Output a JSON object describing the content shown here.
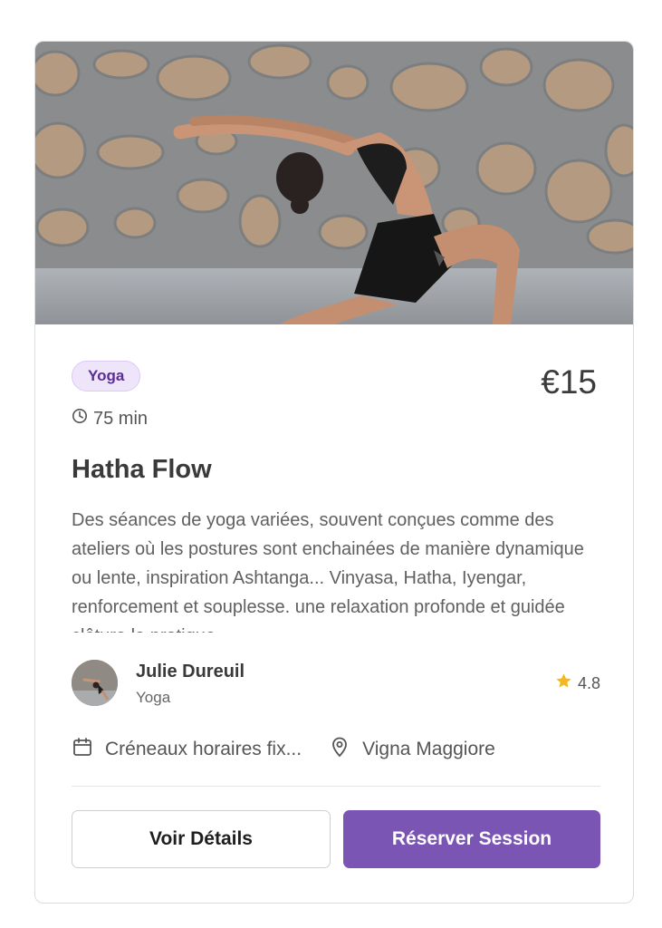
{
  "session": {
    "category": "Yoga",
    "price": "€15",
    "duration": "75 min",
    "title": "Hatha Flow",
    "description": "Des séances de yoga variées, souvent conçues comme des ateliers où les postures sont enchainées de manière dynamique ou lente, inspiration Ashtanga... Vinyasa, Hatha, Iyengar, renforcement et souplesse. une relaxation profonde et guidée clôture la pratique"
  },
  "instructor": {
    "name": "Julie Dureuil",
    "specialty": "Yoga",
    "rating": "4.8"
  },
  "meta": {
    "schedule": "Créneaux horaires fix...",
    "location": "Vigna Maggiore"
  },
  "actions": {
    "details_label": "Voir Détails",
    "book_label": "Réserver Session"
  },
  "icons": {
    "duration": "clock-icon",
    "rating": "star-icon",
    "schedule": "calendar-icon",
    "location": "map-pin-icon"
  },
  "colors": {
    "accent": "#7b55b4",
    "badge_bg": "#efe5fb",
    "badge_text": "#5b2d96",
    "star": "#f2b81f"
  }
}
